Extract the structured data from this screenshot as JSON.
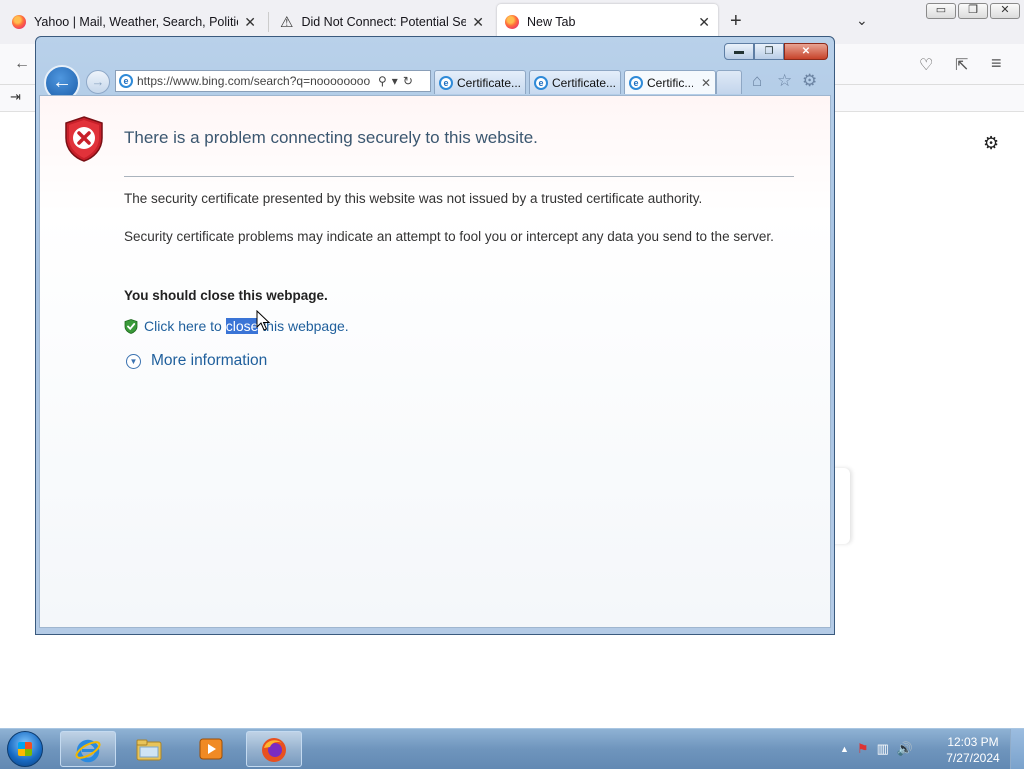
{
  "firefox": {
    "tabs": [
      {
        "label": "Yahoo | Mail, Weather, Search, Politics",
        "close": "✕"
      },
      {
        "label": "Did Not Connect: Potential Security Issue",
        "close": "✕"
      },
      {
        "label": "New Tab",
        "close": "✕"
      }
    ],
    "new_tab": "+",
    "list_all": "⌄",
    "window_controls": {
      "minimize": "▭",
      "restore": "❐",
      "close": "✕"
    },
    "nav_icons": {
      "back": "←",
      "pocket": "♡",
      "extensions": "⇱",
      "menu": "≡"
    },
    "bookmark_icon": "⇥",
    "settings_icon": "⚙"
  },
  "ie": {
    "caption": {
      "minimize": "▬",
      "restore": "❐",
      "close": "✕"
    },
    "back": "←",
    "forward": "→",
    "address": {
      "url": "https://www.bing.com/search?q=noooooooo",
      "search_icon": "⚲",
      "dropdown_icon": "▾",
      "refresh_icon": "↻"
    },
    "tabs": [
      {
        "label": "Certificate..."
      },
      {
        "label": "Certificate..."
      },
      {
        "label": "Certific...",
        "close": "✕"
      }
    ],
    "toolbar": {
      "home": "⌂",
      "favorites": "☆",
      "tools": "⚙"
    },
    "error_page": {
      "title": "There is a problem connecting securely to this website.",
      "line1": "The security certificate presented by this website was not issued by a trusted certificate authority.",
      "line2": "Security certificate problems may indicate an attempt to fool you or intercept any data you send to the server.",
      "recommendation": "You should close this webpage.",
      "close_link": {
        "prefix": "Click here to ",
        "selected": "close",
        "suffix": " this webpage."
      },
      "more_info": "More information",
      "more_info_icon": "▼"
    }
  },
  "taskbar": {
    "tray_arrow": "▲",
    "clock_time": "12:03 PM",
    "clock_date": "7/27/2024",
    "tray_icons": {
      "action_center": "⚑",
      "network": "▥",
      "volume": "🔊"
    }
  }
}
